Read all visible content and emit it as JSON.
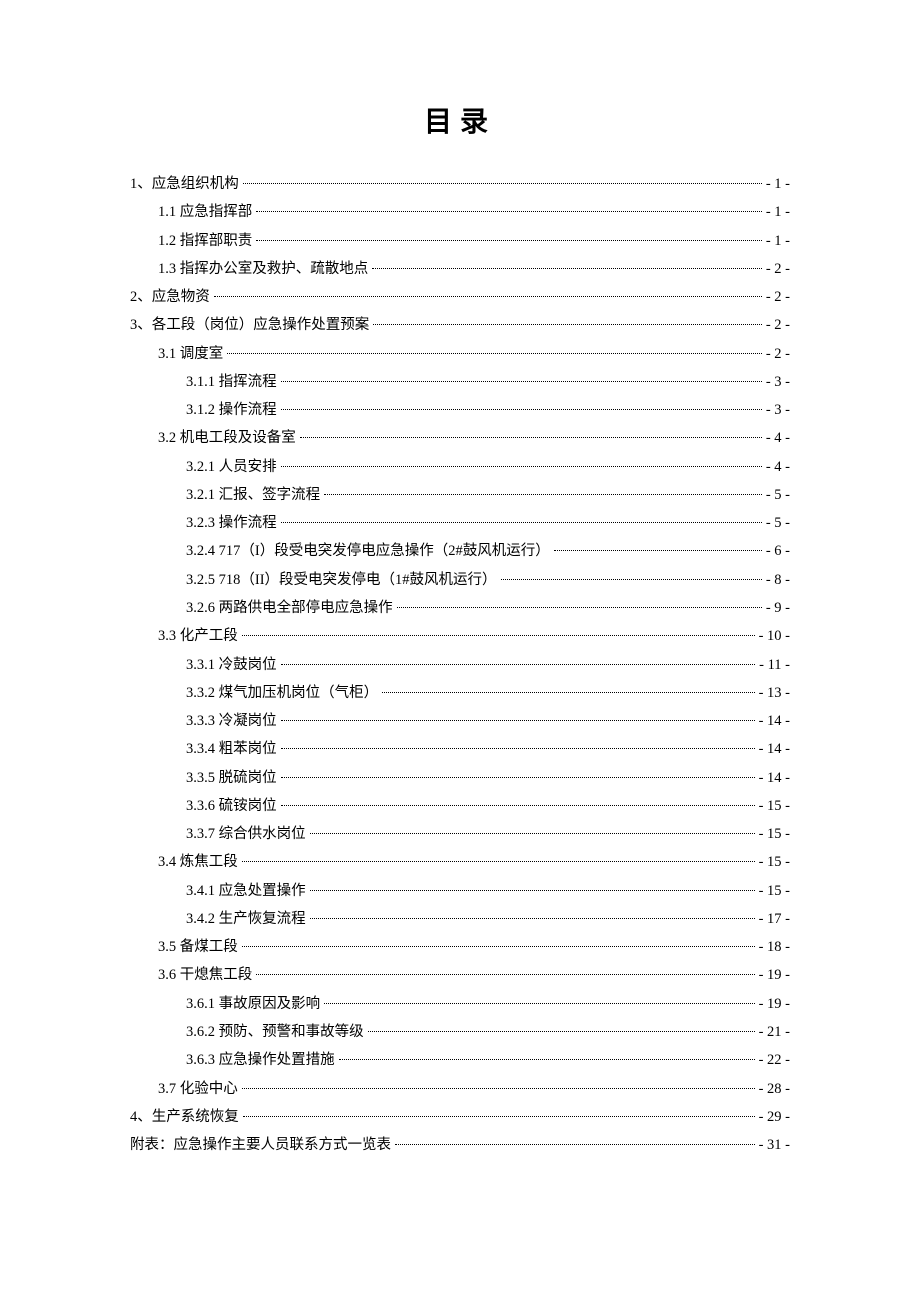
{
  "title": "目录",
  "entries": [
    {
      "level": 0,
      "text": "1、应急组织机构",
      "page": "- 1 -"
    },
    {
      "level": 1,
      "text": "1.1 应急指挥部",
      "page": "- 1 -"
    },
    {
      "level": 1,
      "text": "1.2 指挥部职责",
      "page": "- 1 -"
    },
    {
      "level": 1,
      "text": "1.3 指挥办公室及救护、疏散地点",
      "page": "- 2 -"
    },
    {
      "level": 0,
      "text": "2、应急物资",
      "page": "- 2 -"
    },
    {
      "level": 0,
      "text": "3、各工段（岗位）应急操作处置预案",
      "page": "- 2 -"
    },
    {
      "level": 1,
      "text": "3.1 调度室",
      "page": "- 2 -"
    },
    {
      "level": 2,
      "text": "3.1.1 指挥流程",
      "page": "- 3 -"
    },
    {
      "level": 2,
      "text": "3.1.2 操作流程",
      "page": "- 3 -"
    },
    {
      "level": 1,
      "text": "3.2 机电工段及设备室",
      "page": "- 4 -"
    },
    {
      "level": 2,
      "text": "3.2.1  人员安排",
      "page": "- 4 -"
    },
    {
      "level": 2,
      "text": "3.2.1  汇报、签字流程",
      "page": "- 5 -"
    },
    {
      "level": 2,
      "text": "3.2.3  操作流程",
      "page": "- 5 -"
    },
    {
      "level": 2,
      "text": "3.2.4 717（I）段受电突发停电应急操作（2#鼓风机运行）",
      "page": "- 6 -"
    },
    {
      "level": 2,
      "text": "3.2.5 718（II）段受电突发停电（1#鼓风机运行）",
      "page": "- 8 -"
    },
    {
      "level": 2,
      "text": "3.2.6  两路供电全部停电应急操作",
      "page": "- 9 -"
    },
    {
      "level": 1,
      "text": "3.3 化产工段",
      "page": "- 10 -"
    },
    {
      "level": 2,
      "text": "3.3.1 冷鼓岗位",
      "page": "- 11 -"
    },
    {
      "level": 2,
      "text": "3.3.2 煤气加压机岗位（气柜）",
      "page": "- 13 -"
    },
    {
      "level": 2,
      "text": "3.3.3 冷凝岗位",
      "page": "- 14 -"
    },
    {
      "level": 2,
      "text": "3.3.4 粗苯岗位",
      "page": "- 14 -"
    },
    {
      "level": 2,
      "text": "3.3.5 脱硫岗位",
      "page": "- 14 -"
    },
    {
      "level": 2,
      "text": "3.3.6 硫铵岗位",
      "page": "- 15 -"
    },
    {
      "level": 2,
      "text": "3.3.7 综合供水岗位",
      "page": "- 15 -"
    },
    {
      "level": 1,
      "text": "3.4 炼焦工段",
      "page": "- 15 -"
    },
    {
      "level": 2,
      "text": "3.4.1 应急处置操作",
      "page": "- 15 -"
    },
    {
      "level": 2,
      "text": "3.4.2 生产恢复流程",
      "page": "- 17 -"
    },
    {
      "level": 1,
      "text": "3.5 备煤工段",
      "page": "- 18 -"
    },
    {
      "level": 1,
      "text": "3.6 干熄焦工段",
      "page": "- 19 -"
    },
    {
      "level": 2,
      "text": "3.6.1  事故原因及影响",
      "page": "- 19 -"
    },
    {
      "level": 2,
      "text": "3.6.2  预防、预警和事故等级",
      "page": "- 21 -"
    },
    {
      "level": 2,
      "text": "3.6.3  应急操作处置措施",
      "page": "- 22 -"
    },
    {
      "level": 1,
      "text": "3.7 化验中心",
      "page": "- 28 -"
    },
    {
      "level": 0,
      "text": "4、生产系统恢复",
      "page": "- 29 -"
    },
    {
      "level": 0,
      "text": "附表：应急操作主要人员联系方式一览表",
      "page": "- 31 -"
    }
  ]
}
